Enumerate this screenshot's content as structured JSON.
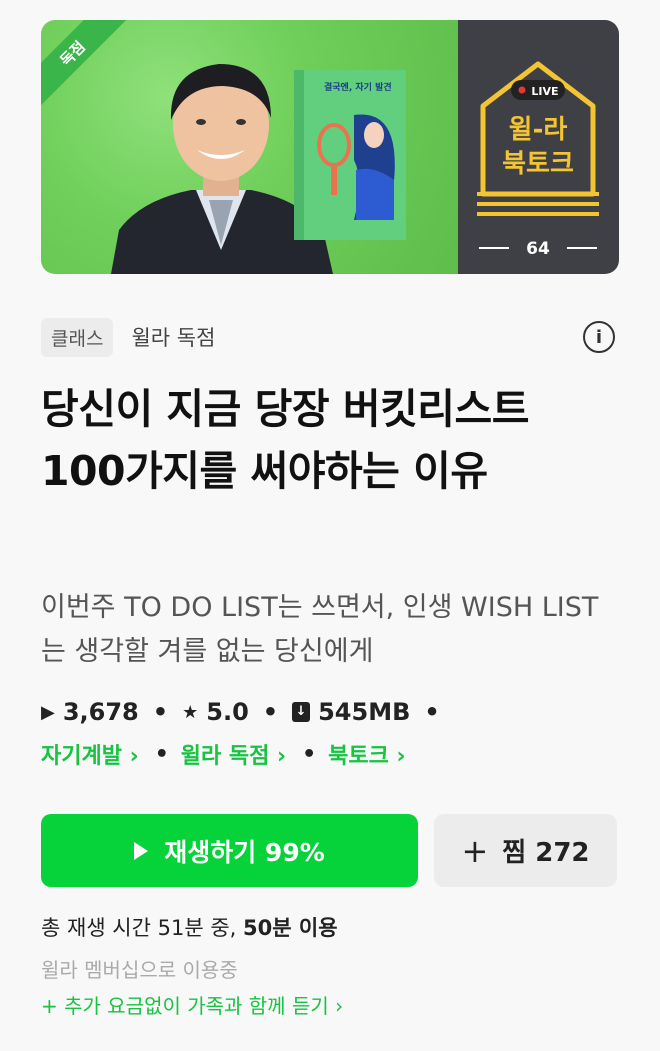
{
  "banner": {
    "ribbon": "독점",
    "book_title": "결국엔, 자기 발견",
    "live_label": "LIVE",
    "show_title_line1": "윌-라",
    "show_title_line2": "북토크",
    "episode": "64",
    "colors": {
      "green": "#6fcf5a",
      "dark": "#3f4046",
      "accent": "#f3c532"
    }
  },
  "tags": {
    "chip": "클래스",
    "text": "윌라 독점",
    "info_icon": "info-icon"
  },
  "title": "당신이 지금 당장 버킷리스트 100가지를 써야하는 이유",
  "subtitle": "이번주 TO DO LIST는 쓰면서, 인생 WISH LIST는 생각할 겨를 없는 당신에게",
  "stats": {
    "plays": "3,678",
    "rating": "5.0",
    "size": "545MB"
  },
  "categories": [
    "자기계발 ›",
    "윌라 독점 ›",
    "북토크 ›"
  ],
  "actions": {
    "play_label": "재생하기 99%",
    "wish_label": "찜 272"
  },
  "playtime": {
    "prefix": "총 재생 시간 51분 중, ",
    "used": "50분 이용"
  },
  "membership": "윌라 멤버십으로 이용중",
  "family": "+ 추가 요금없이 가족과 함께 듣기 ›"
}
